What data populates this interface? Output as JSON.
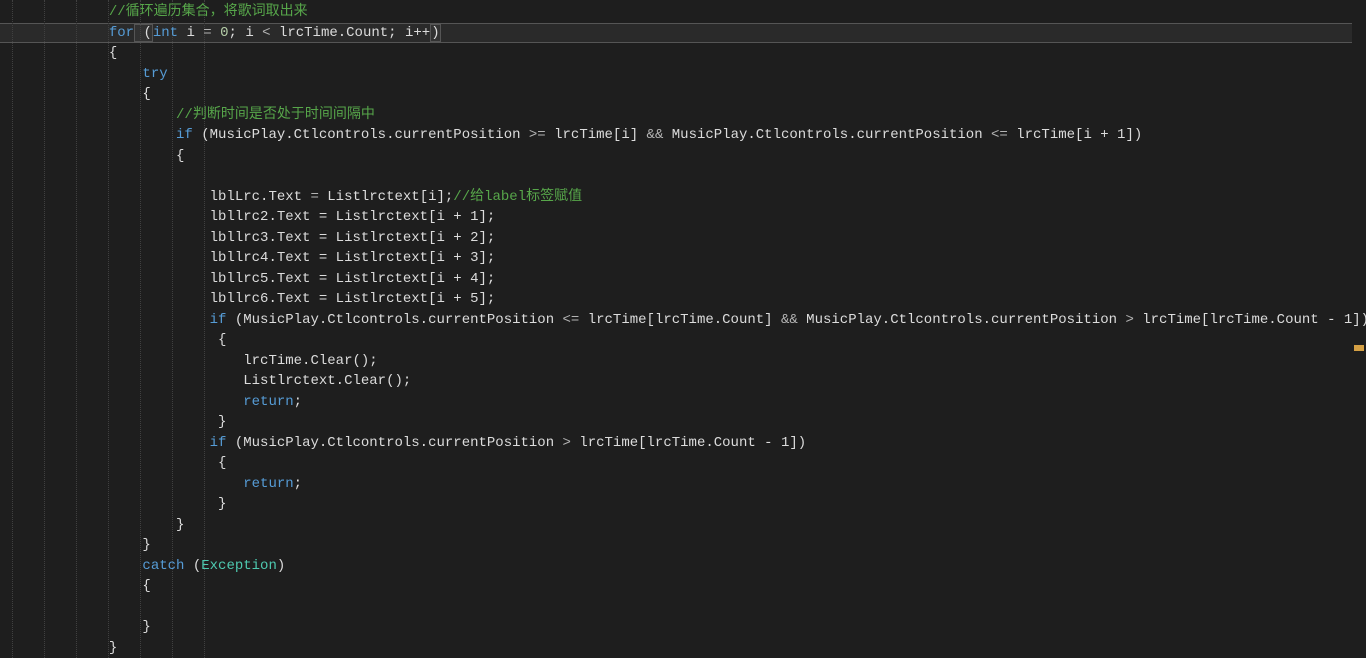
{
  "code": {
    "l1": "//循环遍历集合，将歌词取出来",
    "l2_for": "for",
    "l2_open_paren": " (",
    "l2_int": "int",
    "l2_ivar": " i ",
    "l2_eq": "=",
    "l2_zero": " 0",
    "l2_semi1": "; ",
    "l2_i2": "i ",
    "l2_lt": "<",
    "l2_lrctime": " lrcTime.Count; ",
    "l2_ipp": "i++",
    "l2_close": ")",
    "l3_brace": "{",
    "l4_try": "try",
    "l5_brace": "{",
    "l6_comment": "//判断时间是否处于时间间隔中",
    "l7_if": "if",
    "l7_rest1": " (MusicPlay.Ctlcontrols.currentPosition ",
    "l7_ge": ">=",
    "l7_mid1": " lrcTime[i] ",
    "l7_and": "&&",
    "l7_mid2": " MusicPlay.Ctlcontrols.currentPosition ",
    "l7_le": "<=",
    "l7_end": " lrcTime[i + 1])",
    "l8_brace": "{",
    "l9_empty": "",
    "l10_a": "lblLrc.Text ",
    "l10_eq": "=",
    "l10_b": " Listlrctext[i];",
    "l10_comment": "//给label标签赋值",
    "l11": "lbllrc2.Text = Listlrctext[i + 1];",
    "l12": "lbllrc3.Text = Listlrctext[i + 2];",
    "l13": "lbllrc4.Text = Listlrctext[i + 3];",
    "l14": "lbllrc5.Text = Listlrctext[i + 4];",
    "l15": "lbllrc6.Text = Listlrctext[i + 5];",
    "l16_if": "if",
    "l16_a": " (MusicPlay.Ctlcontrols.currentPosition ",
    "l16_le": "<=",
    "l16_b": " lrcTime[lrcTime.Count] ",
    "l16_and": "&&",
    "l16_c": " MusicPlay.Ctlcontrols.currentPosition ",
    "l16_gt": ">",
    "l16_d": " lrcTime[lrcTime.Count - 1])",
    "l17_brace": "{",
    "l18": "lrcTime.Clear();",
    "l19": "Listlrctext.Clear();",
    "l20_return": "return",
    "l20_semi": ";",
    "l21_brace": "}",
    "l22_if": "if",
    "l22_a": " (MusicPlay.Ctlcontrols.currentPosition ",
    "l22_gt": ">",
    "l22_b": " lrcTime[lrcTime.Count - 1])",
    "l23_brace": "{",
    "l24_return": "return",
    "l24_semi": ";",
    "l25_brace": "}",
    "l26_brace": "}",
    "l27_brace": "}",
    "l28_catch": "catch",
    "l28_paren": " (",
    "l28_exception": "Exception",
    "l28_close": ")",
    "l29_brace": "{",
    "l30_empty": "",
    "l31_brace": "}",
    "l32_brace": "}"
  },
  "indent": {
    "base": "            ",
    "d1": "                ",
    "d2": "                    ",
    "d3": "                        ",
    "d4": "                         ",
    "d5": "                            "
  }
}
